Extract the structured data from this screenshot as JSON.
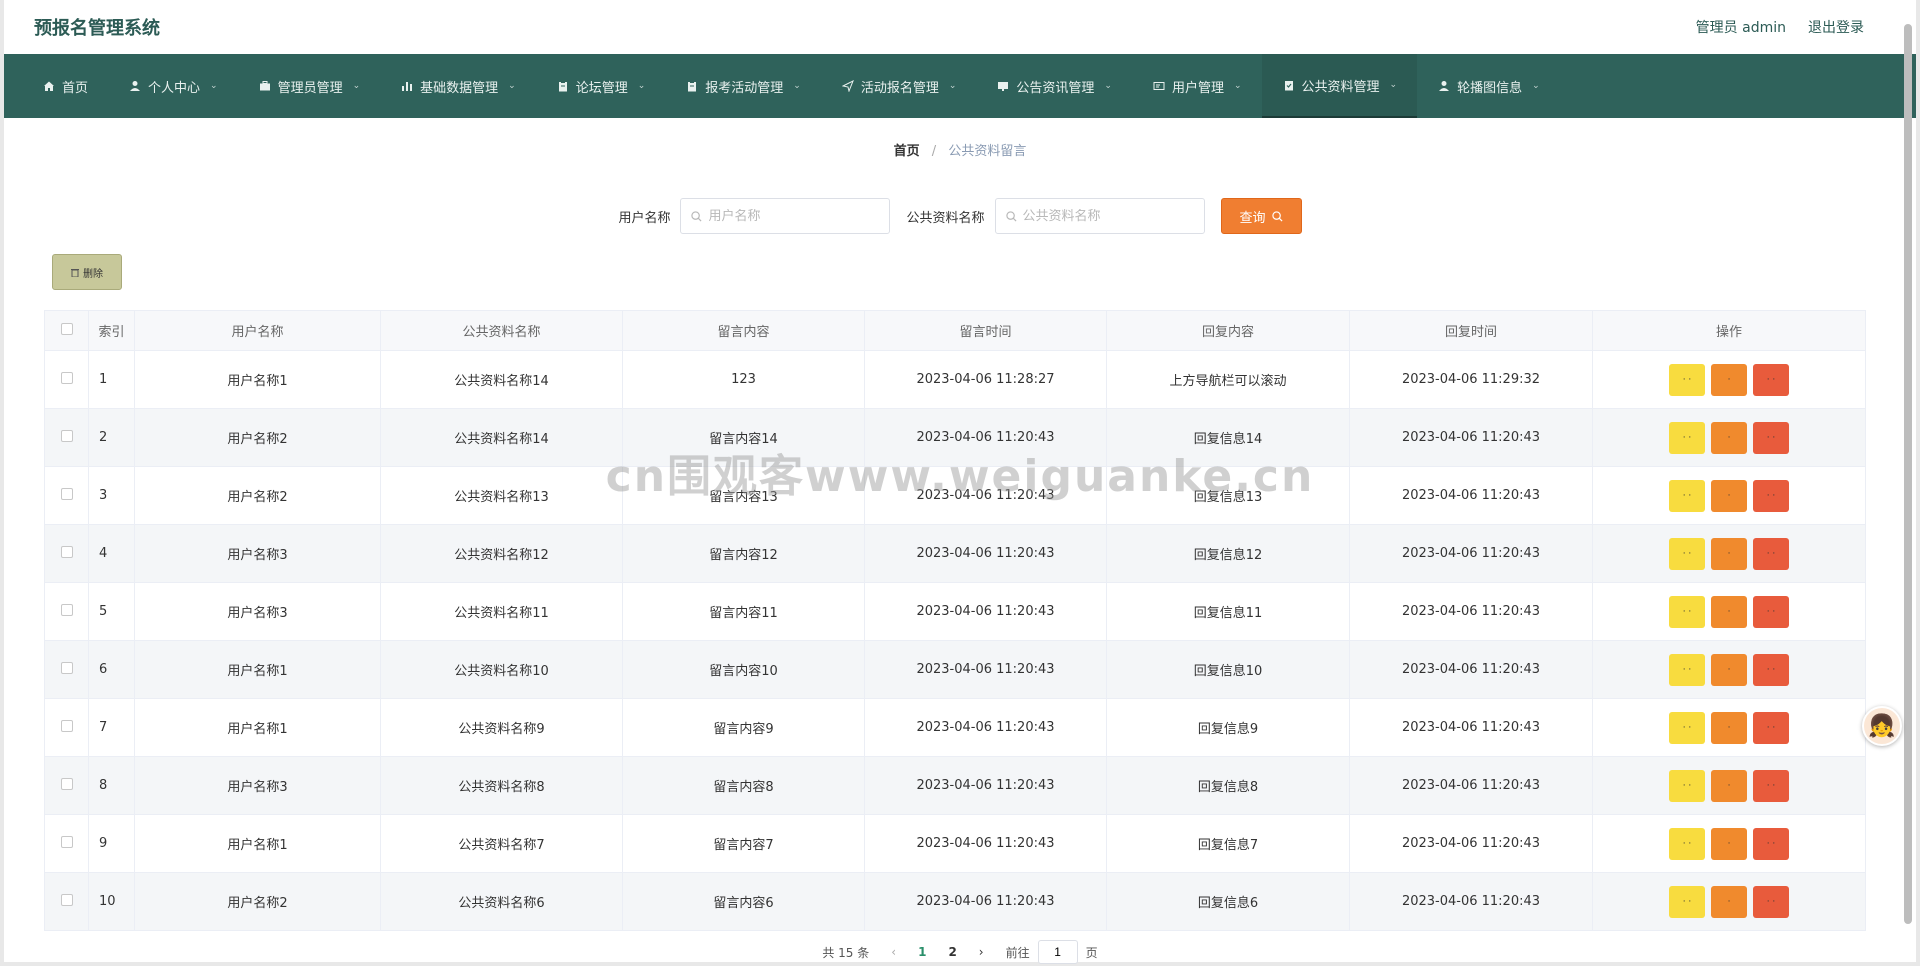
{
  "header": {
    "app_title": "预报名管理系统",
    "user_label": "管理员 admin",
    "logout_label": "退出登录"
  },
  "nav": [
    {
      "label": "首页",
      "icon": "home-icon",
      "caret": false,
      "active": false
    },
    {
      "label": "个人中心",
      "icon": "user-icon",
      "caret": true,
      "active": false
    },
    {
      "label": "管理员管理",
      "icon": "briefcase-icon",
      "caret": true,
      "active": false
    },
    {
      "label": "基础数据管理",
      "icon": "bar-chart-icon",
      "caret": true,
      "active": false
    },
    {
      "label": "论坛管理",
      "icon": "clipboard-icon",
      "caret": true,
      "active": false
    },
    {
      "label": "报考活动管理",
      "icon": "clipboard-icon",
      "caret": true,
      "active": false
    },
    {
      "label": "活动报名管理",
      "icon": "send-icon",
      "caret": true,
      "active": false
    },
    {
      "label": "公告资讯管理",
      "icon": "monitor-icon",
      "caret": true,
      "active": false
    },
    {
      "label": "用户管理",
      "icon": "id-card-icon",
      "caret": true,
      "active": false
    },
    {
      "label": "公共资料管理",
      "icon": "clipboard-check-icon",
      "caret": true,
      "active": true
    },
    {
      "label": "轮播图信息",
      "icon": "user-icon",
      "caret": true,
      "active": false
    }
  ],
  "breadcrumb": {
    "home": "首页",
    "separator": "/",
    "current": "公共资料留言"
  },
  "search": {
    "user_label": "用户名称",
    "user_placeholder": "用户名称",
    "material_label": "公共资料名称",
    "material_placeholder": "公共资料名称",
    "button_label": "查询"
  },
  "delete_button_label": "删除",
  "table": {
    "headers": [
      "索引",
      "用户名称",
      "公共资料名称",
      "留言内容",
      "留言时间",
      "回复内容",
      "回复时间",
      "操作"
    ],
    "rows": [
      {
        "index": "1",
        "user": "用户名称1",
        "material": "公共资料名称14",
        "message": "123",
        "message_time": "2023-04-06 11:28:27",
        "reply": "上方导航栏可以滚动",
        "reply_time": "2023-04-06 11:29:32"
      },
      {
        "index": "2",
        "user": "用户名称2",
        "material": "公共资料名称14",
        "message": "留言内容14",
        "message_time": "2023-04-06 11:20:43",
        "reply": "回复信息14",
        "reply_time": "2023-04-06 11:20:43"
      },
      {
        "index": "3",
        "user": "用户名称2",
        "material": "公共资料名称13",
        "message": "留言内容13",
        "message_time": "2023-04-06 11:20:43",
        "reply": "回复信息13",
        "reply_time": "2023-04-06 11:20:43"
      },
      {
        "index": "4",
        "user": "用户名称3",
        "material": "公共资料名称12",
        "message": "留言内容12",
        "message_time": "2023-04-06 11:20:43",
        "reply": "回复信息12",
        "reply_time": "2023-04-06 11:20:43"
      },
      {
        "index": "5",
        "user": "用户名称3",
        "material": "公共资料名称11",
        "message": "留言内容11",
        "message_time": "2023-04-06 11:20:43",
        "reply": "回复信息11",
        "reply_time": "2023-04-06 11:20:43"
      },
      {
        "index": "6",
        "user": "用户名称1",
        "material": "公共资料名称10",
        "message": "留言内容10",
        "message_time": "2023-04-06 11:20:43",
        "reply": "回复信息10",
        "reply_time": "2023-04-06 11:20:43"
      },
      {
        "index": "7",
        "user": "用户名称1",
        "material": "公共资料名称9",
        "message": "留言内容9",
        "message_time": "2023-04-06 11:20:43",
        "reply": "回复信息9",
        "reply_time": "2023-04-06 11:20:43"
      },
      {
        "index": "8",
        "user": "用户名称3",
        "material": "公共资料名称8",
        "message": "留言内容8",
        "message_time": "2023-04-06 11:20:43",
        "reply": "回复信息8",
        "reply_time": "2023-04-06 11:20:43"
      },
      {
        "index": "9",
        "user": "用户名称1",
        "material": "公共资料名称7",
        "message": "留言内容7",
        "message_time": "2023-04-06 11:20:43",
        "reply": "回复信息7",
        "reply_time": "2023-04-06 11:20:43"
      },
      {
        "index": "10",
        "user": "用户名称2",
        "material": "公共资料名称6",
        "message": "留言内容6",
        "message_time": "2023-04-06 11:20:43",
        "reply": "回复信息6",
        "reply_time": "2023-04-06 11:20:43"
      }
    ]
  },
  "pagination": {
    "total_label": "共 15 条",
    "pages": [
      "1",
      "2"
    ],
    "current_page": "1",
    "goto_prefix": "前往",
    "goto_value": "1",
    "goto_suffix": "页"
  },
  "watermark": "cn围观客www.weiguanke.cn",
  "colors": {
    "nav_bg": "#2f625b",
    "search_button": "#f07e31",
    "delete_button": "#c7c89a",
    "op_view": "#f8dc3f",
    "op_edit": "#f08a2d",
    "op_remove": "#e85b3c"
  }
}
